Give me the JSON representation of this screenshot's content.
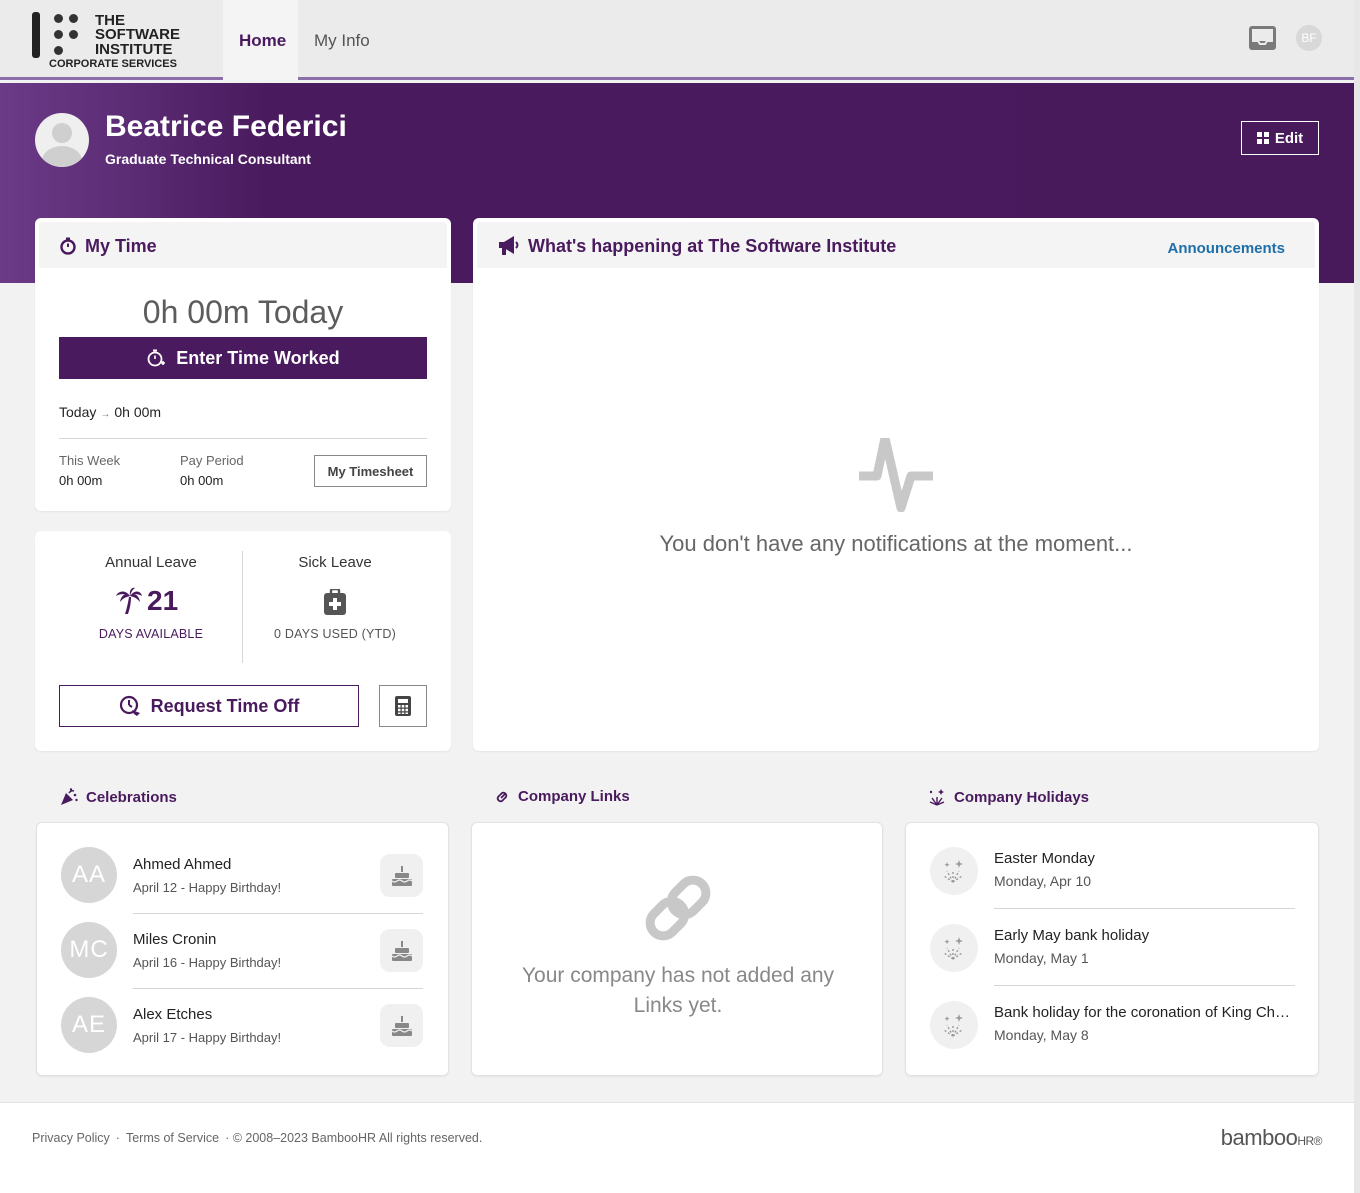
{
  "brand": {
    "logo_lines": [
      "THE",
      "SOFTWARE",
      "INSTITUTE"
    ],
    "logo_sub": "CORPORATE SERVICES"
  },
  "nav": {
    "home": "Home",
    "my_info": "My Info",
    "user_initials": "BF"
  },
  "hero": {
    "name": "Beatrice Federici",
    "job_title": "Graduate Technical Consultant",
    "edit_label": "Edit"
  },
  "my_time": {
    "title": "My Time",
    "total_today": "0h 00m Today",
    "enter_button": "Enter Time Worked",
    "today_label": "Today",
    "today_arrow": "→",
    "today_value": "0h 00m",
    "this_week_label": "This Week",
    "this_week_value": "0h 00m",
    "pay_period_label": "Pay Period",
    "pay_period_value": "0h 00m",
    "timesheet_button": "My Timesheet"
  },
  "leave": {
    "annual": {
      "label": "Annual Leave",
      "value": "21",
      "foot": "DAYS AVAILABLE"
    },
    "sick": {
      "label": "Sick Leave",
      "foot": "0 DAYS USED (YTD)"
    },
    "request_button": "Request Time Off"
  },
  "announcements": {
    "title": "What's happening at The Software Institute",
    "link": "Announcements",
    "empty_message": "You don't have any notifications at the moment..."
  },
  "celebrations": {
    "title": "Celebrations",
    "items": [
      {
        "initials": "AA",
        "name": "Ahmed Ahmed",
        "detail": "April 12 - Happy Birthday!"
      },
      {
        "initials": "MC",
        "name": "Miles Cronin",
        "detail": "April 16 - Happy Birthday!"
      },
      {
        "initials": "AE",
        "name": "Alex Etches",
        "detail": "April 17 - Happy Birthday!"
      }
    ]
  },
  "company_links": {
    "title": "Company Links",
    "empty_message": "Your company has not added any Links yet."
  },
  "holidays": {
    "title": "Company Holidays",
    "items": [
      {
        "name": "Easter Monday",
        "date": "Monday, Apr 10"
      },
      {
        "name": "Early May bank holiday",
        "date": "Monday, May 1"
      },
      {
        "name": "Bank holiday for the coronation of King Charles III",
        "date": "Monday, May 8"
      }
    ]
  },
  "footer": {
    "privacy": "Privacy Policy",
    "sep": "·",
    "terms": "Terms of Service",
    "copyright": "· © 2008–2023 BambooHR All rights reserved.",
    "brand_main": "bamboo",
    "brand_small": "HR®"
  },
  "colors": {
    "brand_purple": "#4a1a5e",
    "link_blue": "#1f6fa8"
  }
}
